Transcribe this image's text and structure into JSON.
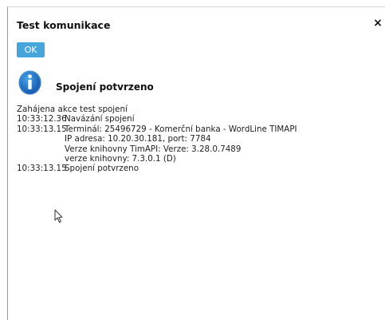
{
  "dialog": {
    "title": "Test komunikace",
    "close_glyph": "×",
    "ok_label": "OK",
    "status_icon": "info-icon",
    "status_text": "Spojení potvrzeno",
    "accent_color": "#46a6dc"
  },
  "log": {
    "header": "Zahájena akce test spojení",
    "entries": [
      {
        "time": "10:33:12.36",
        "text": "Navázání spojení"
      },
      {
        "time": "10:33:13.15",
        "text": "Terminál: 25496729 - Komerční banka - WordLine TIMAPI"
      },
      {
        "time": "",
        "text": "IP adresa: 10.20.30.181, port: 7784"
      },
      {
        "time": "",
        "text": "Verze knihovny TimAPI: Verze: 3.28.0.7489"
      },
      {
        "time": "",
        "text": "verze knihovny: 7.3.0.1 (D)"
      },
      {
        "time": "10:33:13.15",
        "text": "Spojení potvrzeno"
      }
    ]
  }
}
